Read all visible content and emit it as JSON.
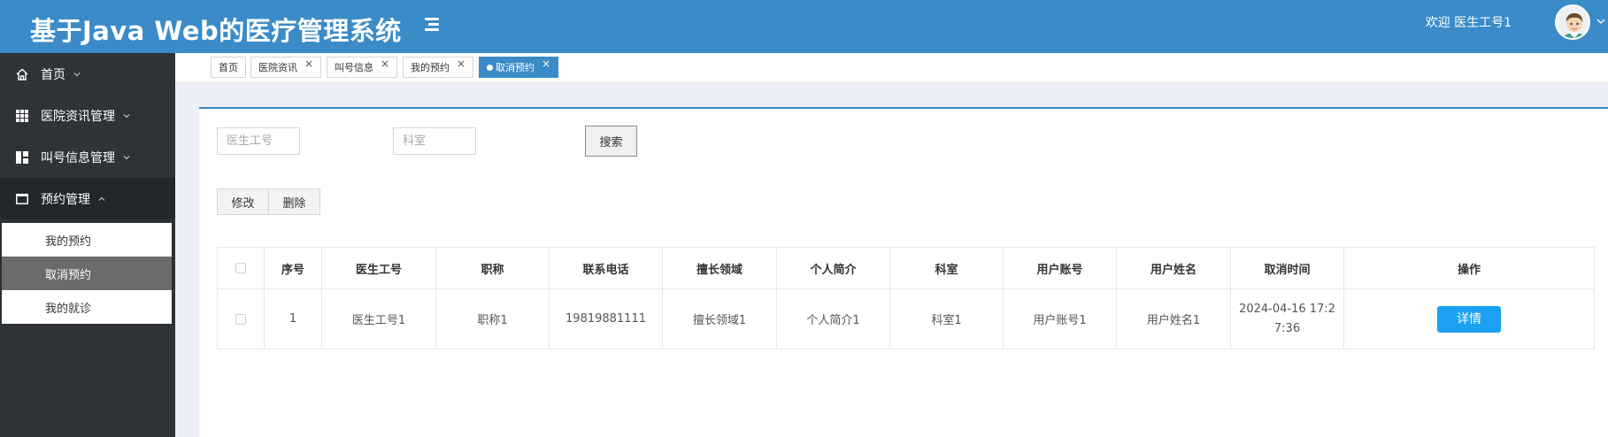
{
  "app": {
    "title": "基于Java Web的医疗管理系统"
  },
  "header": {
    "welcome": "欢迎 医生工号1"
  },
  "sidebar": {
    "items": [
      {
        "label": "首页",
        "icon": "home-icon"
      },
      {
        "label": "医院资讯管理",
        "icon": "grid-icon"
      },
      {
        "label": "叫号信息管理",
        "icon": "dashboard-icon"
      },
      {
        "label": "预约管理",
        "icon": "calendar-icon",
        "expanded": true
      }
    ],
    "submenu": [
      {
        "label": "我的预约"
      },
      {
        "label": "取消预约",
        "active": true
      },
      {
        "label": "我的就诊"
      }
    ]
  },
  "tabs": [
    {
      "label": "首页",
      "closable": false
    },
    {
      "label": "医院资讯",
      "closable": true
    },
    {
      "label": "叫号信息",
      "closable": true
    },
    {
      "label": "我的预约",
      "closable": true
    },
    {
      "label": "取消预约",
      "closable": true,
      "active": true
    }
  ],
  "search": {
    "doctor_no_placeholder": "医生工号",
    "dept_placeholder": "科室",
    "button": "搜索"
  },
  "actions": {
    "edit": "修改",
    "delete": "删除"
  },
  "table": {
    "columns": [
      "序号",
      "医生工号",
      "职称",
      "联系电话",
      "擅长领域",
      "个人简介",
      "科室",
      "用户账号",
      "用户姓名",
      "取消时间",
      "操作"
    ],
    "rows": [
      {
        "index": "1",
        "doctor_no": "医生工号1",
        "title": "职称1",
        "phone": "19819881111",
        "specialty": "擅长领域1",
        "intro": "个人简介1",
        "dept": "科室1",
        "account": "用户账号1",
        "name": "用户姓名1",
        "cancel_time_line1": "2024-04-16 17:2",
        "cancel_time_line2": "7:36",
        "action": "详情"
      }
    ]
  },
  "colors": {
    "header": "#3a8bc8",
    "sidebar": "#2f3337",
    "detail_button": "#1aa1f1",
    "content_bg": "#eceff5"
  }
}
